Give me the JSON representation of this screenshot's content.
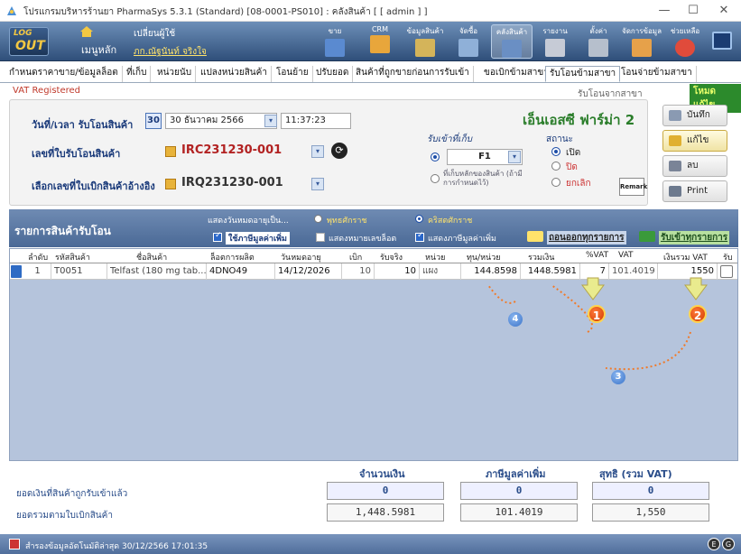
{
  "window": {
    "title": "โปรแกรมบริหารร้านยา PharmaSys 5.3.1 (Standard) [08-0001-PS010] : คลังสินค้า [ [ admin ] ]",
    "minimize": "—",
    "maximize": "☐",
    "close": "✕"
  },
  "toolbar": {
    "logo_line1": "LOG",
    "logo_line2": "OUT",
    "main_menu": "เมนูหลัก",
    "switch_user": "เปลี่ยนผู้ใช้",
    "user_name": "ภก.ณัฐนันท์ จริงใจ",
    "buttons": [
      "ขาย",
      "CRM",
      "ข้อมูลสินค้า",
      "จัดซื้อ",
      "คลังสินค้า",
      "รายงาน",
      "",
      "ตั้งค่า",
      "จัดการข้อมูล",
      "ช่วยเหลือ"
    ]
  },
  "tabs": [
    "กำหนดราคาขาย/ข้อมูลล็อต",
    "ที่เก็บ",
    "หน่วยนับ",
    "แปลงหน่วยสินค้า",
    "โอนย้าย",
    "ปรับยอด",
    "สินค้าที่ถูกขายก่อนการรับเข้า",
    "ขอเบิกข้ามสาขา",
    "รับโอนข้ามสาขา",
    "โอนจ่ายข้ามสาขา"
  ],
  "active_tab_index": 8,
  "vat_registered": "VAT Registered",
  "subtitle": "รับโอนจากสาขา",
  "mode_badge": "โหมดแก้ไข",
  "header": {
    "datetime_label": "วันที่/เวลา รับโอนสินค้า",
    "date_day_badge": "30",
    "date_value": "30  ธันวาคม  2566",
    "time_value": "11:37:23",
    "company": "เอ็นเอสซี ฟาร์ม่า 2",
    "receive_doc_label": "เลขที่ใบรับโอนสินค้า",
    "receive_doc_no": "IRC231230-001",
    "ref_doc_label": "เลือกเลขที่ใบเบิกสินค้าอ้างอิง",
    "ref_doc_no": "IRQ231230-001",
    "store_group_title": "รับเข้าที่เก็บ",
    "store_value": "F1",
    "store_alt": "ที่เก็บหลักของสินค้า (ถ้ามีการกำหนดไว้)",
    "status_title": "สถานะ",
    "status_open": "เปิด",
    "status_closed": "ปิด",
    "status_cancel": "ยกเลิก",
    "remark": "Remark"
  },
  "side_buttons": {
    "save": "บันทึก",
    "edit": "แก้ไข",
    "delete": "ลบ",
    "print": "Print"
  },
  "items": {
    "title": "รายการสินค้ารับโอน",
    "show_expiry_as": "แสดงวันหมดอายุเป็น...",
    "buddhist_era": "พุทธศักราช",
    "christian_era": "คริสตศักราช",
    "use_vat": "ใช้ภาษีมูลค่าเพิ่ม",
    "show_lot_no": "แสดงหมายเลขล็อต",
    "show_vat": "แสดงภาษีมูลค่าเพิ่ม",
    "remove_all": "ถอนออกทุกรายการ",
    "receive_all": "รับเข้าทุกรายการ",
    "columns": [
      "ลำดับ",
      "รหัสสินค้า",
      "ชื่อสินค้า",
      "ล็อตการผลิต",
      "วันหมดอายุ",
      "เบิก",
      "รับจริง",
      "หน่วย",
      "ทุน/หน่วย",
      "รวมเงิน",
      "%VAT",
      "VAT",
      "เงินรวม VAT",
      "รับ"
    ],
    "rows": [
      {
        "no": "1",
        "code": "T0051",
        "name": "Telfast (180 mg tab...",
        "lot": "4DNO49",
        "expiry": "14/12/2026",
        "requested": "10",
        "received": "10",
        "unit": "แผง",
        "unit_cost": "144.8598",
        "amount": "1448.5981",
        "vat_pct": "7",
        "vat": "101.4019",
        "total_vat": "1550"
      }
    ]
  },
  "annotations": [
    "1",
    "2",
    "3",
    "4"
  ],
  "summary": {
    "col_amount": "จำนวนเงิน",
    "col_vat": "ภาษีมูลค่าเพิ่ม",
    "col_net": "สุทธิ (รวม VAT)",
    "received_label": "ยอดเงินที่สินค้าถูกรับเข้าแล้ว",
    "requested_label": "ยอดรวมตามใบเบิกสินค้า",
    "received_amount": "0",
    "received_vat": "0",
    "received_net": "0",
    "requested_amount": "1,448.5981",
    "requested_vat": "101.4019",
    "requested_net": "1,550"
  },
  "status": {
    "text": "สำรองข้อมูลอัตโนมัติล่าสุด  30/12/2566 17:01:35"
  },
  "colors": {
    "toolbar": "#2f4f7a",
    "accent_red": "#b22222",
    "company_green": "#2a7d2a",
    "annotation_red": "#d13b00",
    "annotation_blue": "#3b74c9"
  }
}
